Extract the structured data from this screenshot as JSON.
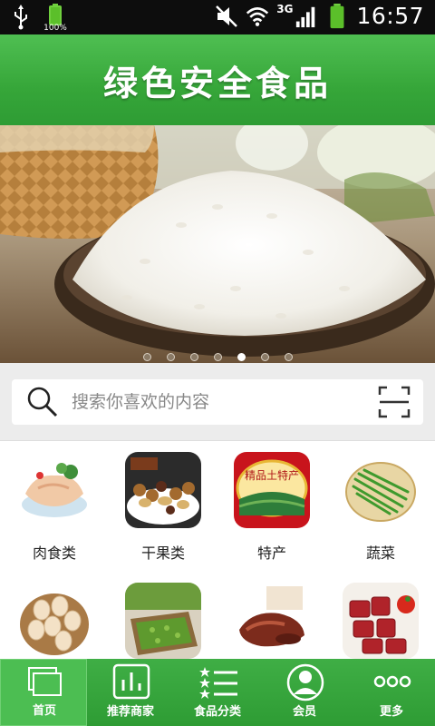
{
  "status_bar": {
    "battery_percent": "100%",
    "network": "3G",
    "time": "16:57"
  },
  "header": {
    "title": "绿色安全食品"
  },
  "banner": {
    "slide_count": 7,
    "active_slide": 5
  },
  "search": {
    "placeholder": "搜索你喜欢的内容"
  },
  "categories": [
    {
      "label": "肉食类"
    },
    {
      "label": "干果类"
    },
    {
      "label": "特产"
    },
    {
      "label": "蔬菜"
    },
    {
      "label": ""
    },
    {
      "label": ""
    },
    {
      "label": ""
    },
    {
      "label": ""
    }
  ],
  "specialty_badge": "精品土特产",
  "tabbar": {
    "items": [
      {
        "label": "首页",
        "icon": "home-icon",
        "active": true
      },
      {
        "label": "推荐商家",
        "icon": "chart-icon",
        "active": false
      },
      {
        "label": "食品分类",
        "icon": "list-icon",
        "active": false
      },
      {
        "label": "会员",
        "icon": "user-icon",
        "active": false
      },
      {
        "label": "更多",
        "icon": "more-icon",
        "active": false
      }
    ]
  },
  "colors": {
    "brand_green": "#36a639",
    "statusbar": "#0d0d0d",
    "battery_green": "#5bbf2a"
  }
}
